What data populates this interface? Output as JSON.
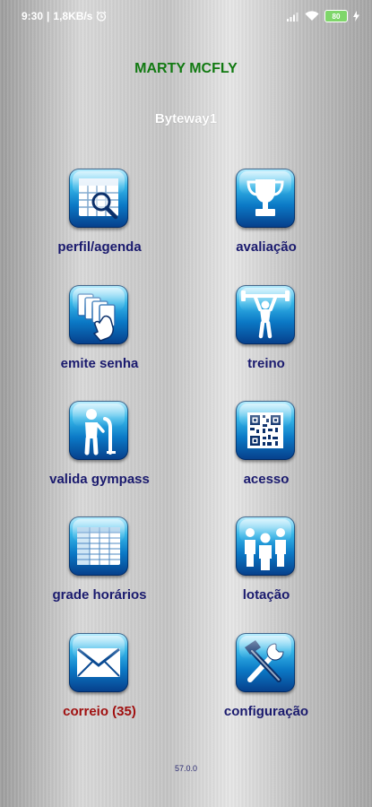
{
  "status_bar": {
    "time": "9:30",
    "network_speed": "1,8KB/s",
    "battery_level": "80"
  },
  "user_name": "MARTY MCFLY",
  "company": "Byteway1",
  "menu": [
    {
      "label": "perfil/agenda",
      "icon": "calendar-search-icon"
    },
    {
      "label": "avaliação",
      "icon": "trophy-icon"
    },
    {
      "label": "emite senha",
      "icon": "cards-hand-icon"
    },
    {
      "label": "treino",
      "icon": "weightlifter-icon"
    },
    {
      "label": "valida gympass",
      "icon": "person-scanner-icon"
    },
    {
      "label": "acesso",
      "icon": "qr-code-icon"
    },
    {
      "label": "grade horários",
      "icon": "schedule-grid-icon"
    },
    {
      "label": "lotação",
      "icon": "people-group-icon"
    },
    {
      "label": "correio (35)",
      "icon": "envelope-icon",
      "color": "#a01010"
    },
    {
      "label": "configuração",
      "icon": "tools-icon"
    }
  ],
  "version": "57.0.0"
}
